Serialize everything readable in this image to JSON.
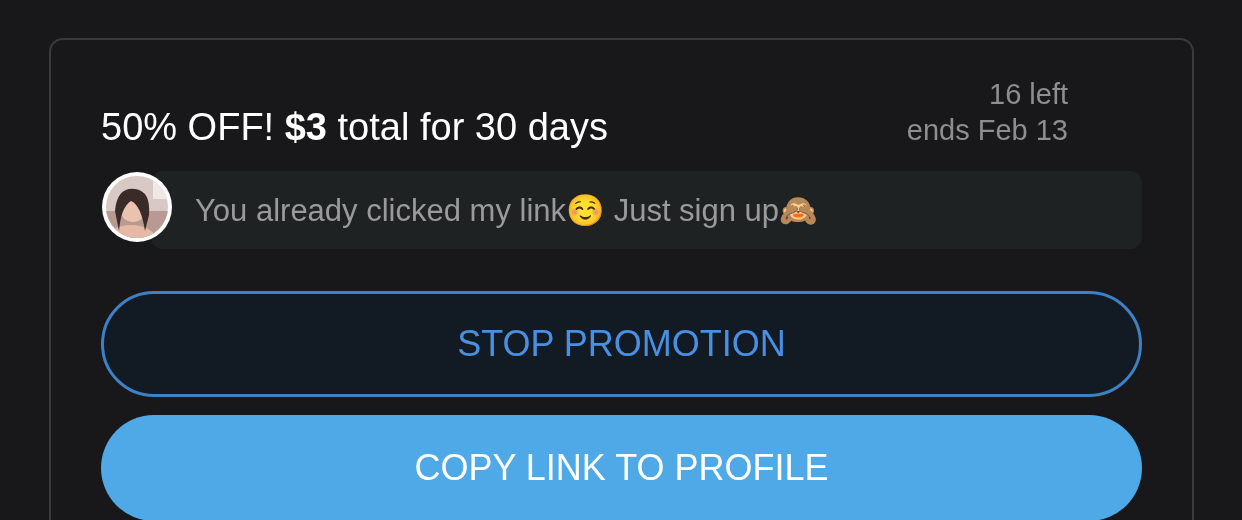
{
  "promotion": {
    "title": "50% OFF! **$3** total for 30 days",
    "remaining": "16 left",
    "ends": "ends Feb 13",
    "message": {
      "text": "You already clicked my link☺️ Just sign up🙈"
    },
    "buttons": [
      {
        "label": "STOP PROMOTION",
        "kind": "outline"
      },
      {
        "label": "COPY LINK TO PROFILE",
        "kind": "filled"
      }
    ]
  }
}
